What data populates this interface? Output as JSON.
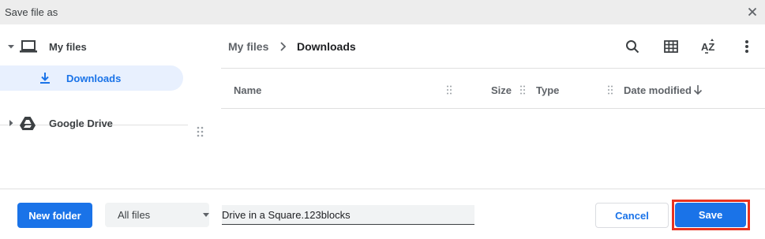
{
  "window": {
    "title": "Save file as"
  },
  "sidebar": {
    "items": [
      {
        "label": "My files",
        "icon": "laptop-icon",
        "expanded": true
      },
      {
        "label": "Downloads",
        "icon": "download-icon",
        "selected": true
      },
      {
        "label": "Google Drive",
        "icon": "google-drive-icon",
        "expanded": false
      }
    ]
  },
  "breadcrumb": {
    "root": "My files",
    "current": "Downloads"
  },
  "toolbar": {
    "icons": [
      "search-icon",
      "grid-view-icon",
      "sort-az-icon",
      "more-vert-icon"
    ]
  },
  "columns": {
    "name": "Name",
    "size": "Size",
    "type": "Type",
    "date_modified": "Date modified",
    "sort_direction": "descending"
  },
  "footer": {
    "new_folder": "New folder",
    "file_type_filter": "All files",
    "filename_value": "Drive in a Square.123blocks",
    "cancel": "Cancel",
    "save": "Save"
  },
  "colors": {
    "accent": "#1a73e8",
    "selected_bg": "#e8f0fe",
    "highlight_border": "#e8321f",
    "titlebar_bg": "#ededed"
  }
}
